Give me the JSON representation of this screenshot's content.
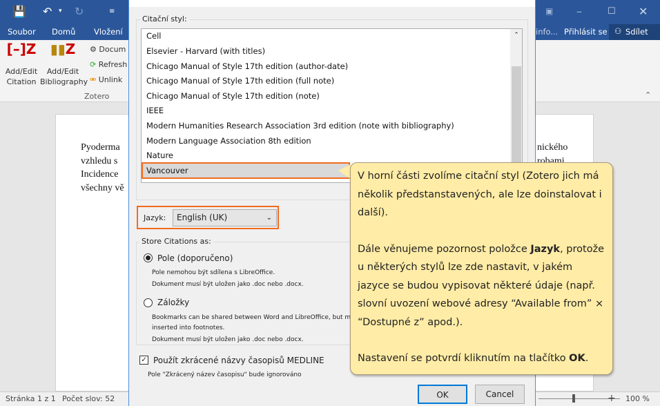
{
  "word": {
    "tabs": [
      "Soubor",
      "Domů",
      "Vložení"
    ],
    "right_tabs": {
      "info": "info...",
      "signin": "Přihlásit se",
      "share": "Sdílet"
    },
    "ribbon": {
      "add_edit_citation": [
        "Add/Edit",
        "Citation"
      ],
      "add_edit_bibliography": [
        "Add/Edit",
        "Bibliography"
      ],
      "document_prefs": "Docum",
      "refresh": "Refresh",
      "unlink": "Unlink",
      "group_label": "Zotero"
    },
    "document_lines": [
      "Pyoderma",
      "vzhledu s",
      "Incidence",
      "všechny vě"
    ],
    "document_right": [
      "nického",
      "robami"
    ],
    "status": {
      "page": "Stránka 1 z 1",
      "words": "Počet slov: 52",
      "zoom": "100 %"
    },
    "accent": "#2b579a"
  },
  "dialog": {
    "style_group_label": "Citační styl:",
    "styles": [
      "Cell",
      "Elsevier - Harvard (with titles)",
      "Chicago Manual of Style 17th edition (author-date)",
      "Chicago Manual of Style 17th edition (full note)",
      "Chicago Manual of Style 17th edition (note)",
      "IEEE",
      "Modern Humanities Research Association 3rd edition (note with bibliography)",
      "Modern Language Association 8th edition",
      "Nature",
      "Vancouver"
    ],
    "selected_style": "Vancouver",
    "language_label": "Jazyk:",
    "language_value": "English (UK)",
    "store_label": "Store Citations as:",
    "fields_option": "Pole (doporučeno)",
    "fields_selected": true,
    "fields_note1": "Pole nemohou být sdílena s LibreOffice.",
    "fields_note2": "Dokument musí být uložen jako .doc nebo .docx.",
    "bookmarks_option": "Záložky",
    "bookmarks_note1": "Bookmarks can be shared between Word and LibreOffice, but may",
    "bookmarks_note1b": "inserted into footnotes.",
    "bookmarks_note2": "Dokument musí být uložen jako .doc nebo .docx.",
    "medline_label": "Použít zkrácené názvy časopisů MEDLINE",
    "medline_checked": true,
    "medline_note": "Pole \"Zkrácený název časopisu\" bude ignorováno",
    "ok": "OK",
    "cancel": "Cancel",
    "highlight_color": "#f26b1d"
  },
  "callout": {
    "p1": "V horní části zvolíme citační styl (Zotero jich má několik předstanstavených, ale lze doinstalovat i další).",
    "p2_a": "Dále věnujeme pozornost položce ",
    "p2_bold": "Jazyk",
    "p2_b": ", protože u některých stylů lze zde nastavit, v jakém jazyce se budou vypisovat některé údaje (např. slovní uvození webové adresy “Available from” × “Dostupné z” apod.).",
    "p3_a": "Nastavení se potvrdí kliknutím na tlačítko ",
    "p3_bold": "OK",
    "p3_b": ".",
    "bg_color": "#ffeca6"
  }
}
